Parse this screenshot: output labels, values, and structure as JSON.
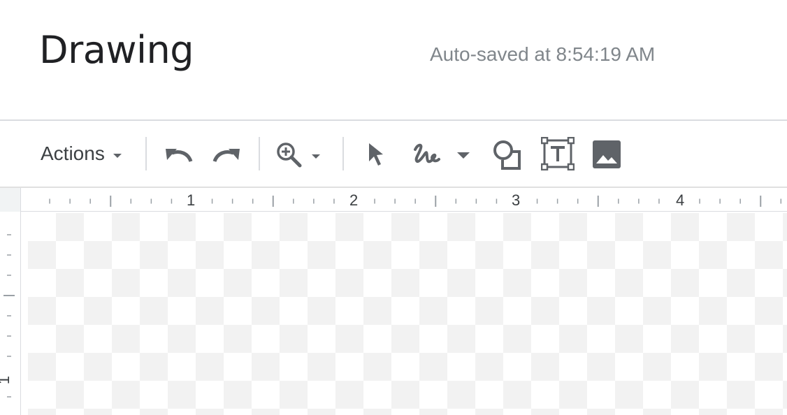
{
  "header": {
    "title": "Drawing",
    "autosave_text": "Auto-saved at 8:54:19 AM"
  },
  "toolbar": {
    "actions_label": "Actions",
    "icons": {
      "undo": "undo-icon",
      "redo": "redo-icon",
      "zoom": "zoom-in-icon",
      "select": "select-cursor-icon",
      "line": "scribble-line-icon",
      "shape": "shape-icon",
      "text_box": "text-box-icon",
      "image": "image-icon"
    }
  },
  "ruler": {
    "horizontal_numbers": [
      "1",
      "2",
      "3",
      "4"
    ],
    "vertical_numbers": [
      "1"
    ]
  },
  "colors": {
    "icon": "#5f6368",
    "text": "#3c4043",
    "divider": "#dadce0",
    "checker": "#f2f2f2"
  }
}
